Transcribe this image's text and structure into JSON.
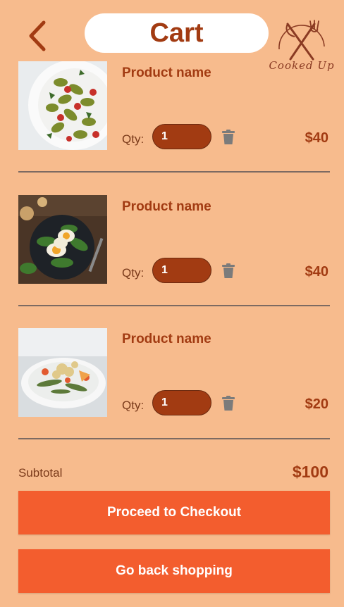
{
  "header": {
    "title": "Cart",
    "logo_text": "Cooked Up",
    "back_icon": "chevron-left-icon",
    "logo_icon": "fork-knife-icon"
  },
  "colors": {
    "background": "#f7bb8d",
    "accent": "#a23b12",
    "button": "#f35d2e"
  },
  "cart": {
    "items": [
      {
        "name": "Product name",
        "qty_label": "Qty:",
        "qty": "1",
        "price": "$40"
      },
      {
        "name": "Product name",
        "qty_label": "Qty:",
        "qty": "1",
        "price": "$40"
      },
      {
        "name": "Product name",
        "qty_label": "Qty:",
        "qty": "1",
        "price": "$20"
      }
    ],
    "delete_icon": "trash-icon"
  },
  "summary": {
    "subtotal_label": "Subtotal",
    "subtotal_value": "$100"
  },
  "actions": {
    "checkout_label": "Proceed to Checkout",
    "back_shopping_label": "Go back shopping"
  }
}
